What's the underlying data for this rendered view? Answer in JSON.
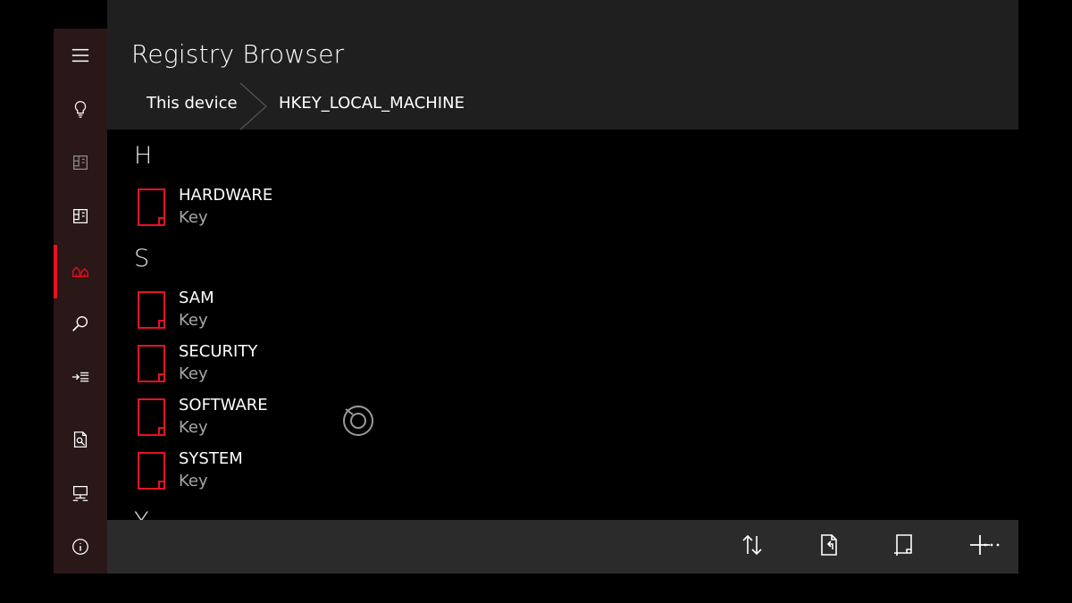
{
  "app": {
    "title": "Registry Browser"
  },
  "breadcrumb": [
    {
      "label": "This device"
    },
    {
      "label": "HKEY_LOCAL_MACHINE"
    }
  ],
  "nav": {
    "items": [
      {
        "icon": "hamburger-menu-icon"
      },
      {
        "icon": "lightbulb-icon"
      },
      {
        "icon": "registry-hive-icon"
      },
      {
        "icon": "registry-editor-icon"
      },
      {
        "icon": "registry-browser-icon",
        "active": true
      },
      {
        "icon": "search-icon"
      },
      {
        "icon": "import-icon"
      },
      {
        "icon": "document-search-icon"
      },
      {
        "icon": "remote-computer-icon"
      },
      {
        "icon": "info-icon"
      }
    ]
  },
  "groups": [
    {
      "letter": "H",
      "items": [
        {
          "name": "HARDWARE",
          "type": "Key"
        }
      ]
    },
    {
      "letter": "S",
      "items": [
        {
          "name": "SAM",
          "type": "Key"
        },
        {
          "name": "SECURITY",
          "type": "Key"
        },
        {
          "name": "SOFTWARE",
          "type": "Key"
        },
        {
          "name": "SYSTEM",
          "type": "Key"
        }
      ]
    },
    {
      "letter": "Y",
      "items": []
    }
  ],
  "commandbar": {
    "buttons": [
      {
        "icon": "sort-icon"
      },
      {
        "icon": "open-document-icon"
      },
      {
        "icon": "new-key-icon"
      },
      {
        "icon": "add-icon"
      },
      {
        "icon": "more-icon"
      }
    ]
  },
  "colors": {
    "accent": "#e81123",
    "rail_bg": "#2a1717",
    "header_bg": "#1f1f1f",
    "cmdbar_bg": "#2b2b2b",
    "content_bg": "#000000"
  }
}
